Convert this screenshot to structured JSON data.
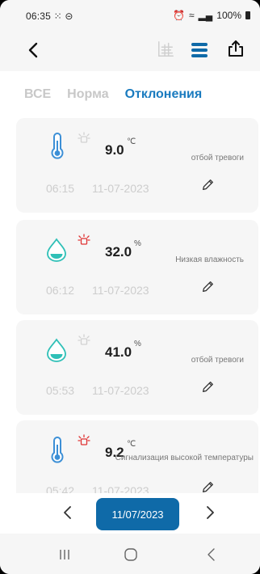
{
  "statusbar": {
    "time": "06:35",
    "time_icons": "⁙ ⊝",
    "battery": "100%"
  },
  "tabs": [
    {
      "label": "ВСЕ"
    },
    {
      "label": "Норма"
    },
    {
      "label": "Отклонения"
    }
  ],
  "cards": [
    {
      "value": "9.0",
      "unit": "℃",
      "status": "отбой тревоги",
      "time": "06:15",
      "date": "11-07-2023",
      "sensor": "thermometer",
      "alarm_active": false
    },
    {
      "value": "32.0",
      "unit": "%",
      "status": "Низкая влажность",
      "time": "06:12",
      "date": "11-07-2023",
      "sensor": "humidity",
      "alarm_active": true
    },
    {
      "value": "41.0",
      "unit": "%",
      "status": "отбой тревоги",
      "time": "05:53",
      "date": "11-07-2023",
      "sensor": "humidity",
      "alarm_active": false
    },
    {
      "value": "9.2",
      "unit": "℃",
      "status": "Сигнализация высокой температуры",
      "time": "05:42",
      "date": "11-07-2023",
      "sensor": "thermometer",
      "alarm_active": true
    }
  ],
  "date_nav": {
    "selected_date": "11/07/2023"
  },
  "colors": {
    "accent": "#1a7bbf",
    "button": "#0f6aa8",
    "alarm_red": "#e03434",
    "alarm_grey": "#d2d2d2",
    "thermo": "#3c8fd6",
    "humidity": "#2fc0b7"
  }
}
